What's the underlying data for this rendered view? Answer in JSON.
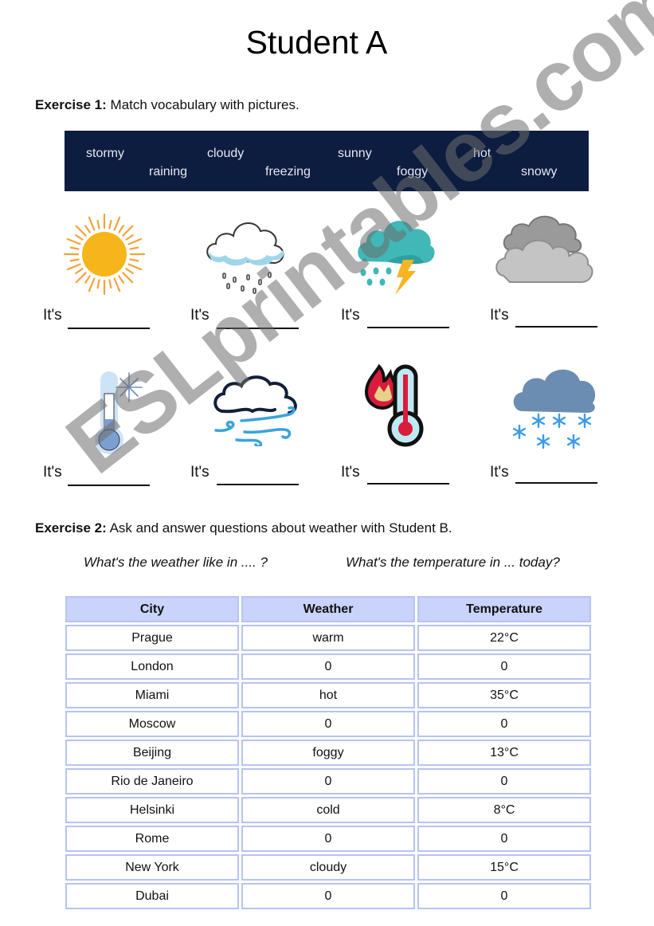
{
  "page_title": "Student A",
  "exercise1": {
    "label": "Exercise 1:",
    "instruction": "Match vocabulary with pictures.",
    "word_bank": [
      "stormy",
      "raining",
      "cloudy",
      "freezing",
      "sunny",
      "foggy",
      "hot",
      "snowy"
    ],
    "prompt": "It's",
    "pictures": [
      {
        "icon": "sun-icon"
      },
      {
        "icon": "rain-cloud-icon"
      },
      {
        "icon": "storm-cloud-icon"
      },
      {
        "icon": "grey-clouds-icon"
      },
      {
        "icon": "cold-thermometer-snowflake-icon"
      },
      {
        "icon": "cloud-wind-icon"
      },
      {
        "icon": "hot-thermometer-flame-icon"
      },
      {
        "icon": "snow-cloud-icon"
      }
    ]
  },
  "exercise2": {
    "label": "Exercise 2:",
    "instruction": "Ask and answer questions about weather with Student B.",
    "question1": "What's the weather like in .... ?",
    "question2": "What's the temperature in ... today?",
    "table": {
      "headers": [
        "City",
        "Weather",
        "Temperature"
      ],
      "rows": [
        [
          "Prague",
          "warm",
          "22°C"
        ],
        [
          "London",
          "0",
          "0"
        ],
        [
          "Miami",
          "hot",
          "35°C"
        ],
        [
          "Moscow",
          "0",
          "0"
        ],
        [
          "Beijing",
          "foggy",
          "13°C"
        ],
        [
          "Rio de Janeiro",
          "0",
          "0"
        ],
        [
          "Helsinki",
          "cold",
          "8°C"
        ],
        [
          "Rome",
          "0",
          "0"
        ],
        [
          "New York",
          "cloudy",
          "15°C"
        ],
        [
          "Dubai",
          "0",
          "0"
        ]
      ]
    }
  },
  "watermark": "ESLprintables.com",
  "colors": {
    "word_bank_bg": "#0d1d40",
    "table_header_bg": "#c9d3fb",
    "table_border": "#b7c3f3"
  }
}
